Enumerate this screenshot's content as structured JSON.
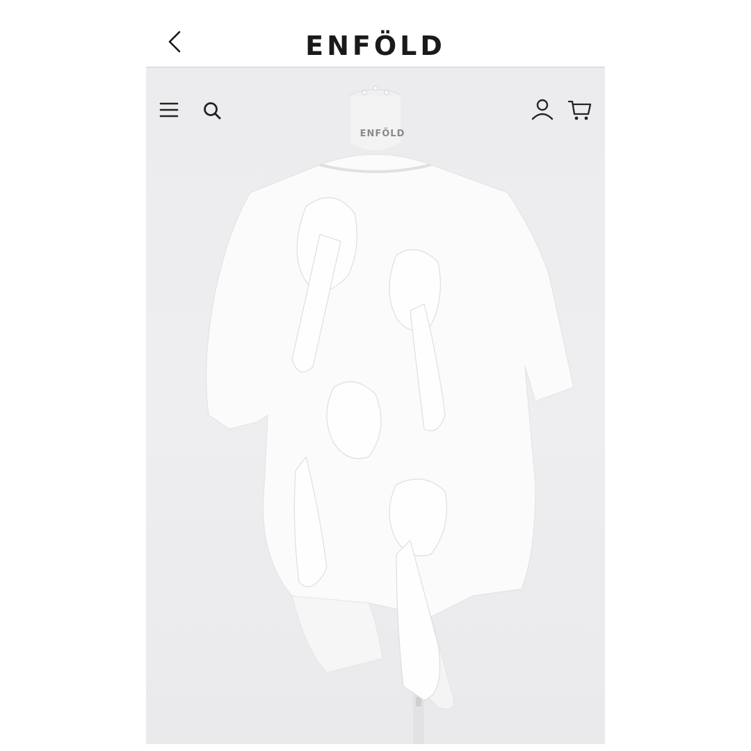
{
  "header": {
    "logo_text": "ENFÖLD",
    "back_icon": "chevron-left-icon"
  },
  "photo_overlay": {
    "menu_icon": "hamburger-menu-icon",
    "search_icon": "search-icon",
    "account_icon": "user-icon",
    "cart_icon": "cart-icon"
  },
  "mannequin": {
    "label": "ENFÖLD",
    "sublabel": ""
  },
  "colors": {
    "background": "#ffffff",
    "photo_backdrop": "#ececee",
    "text_dark": "#1a1a1a",
    "garment": "#fafafa"
  }
}
